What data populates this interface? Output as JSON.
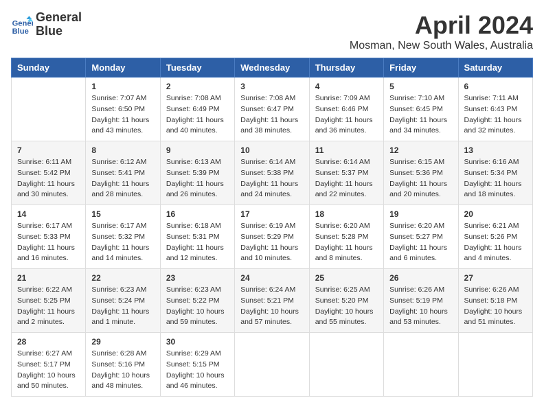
{
  "header": {
    "logo_line1": "General",
    "logo_line2": "Blue",
    "month_year": "April 2024",
    "location": "Mosman, New South Wales, Australia"
  },
  "weekdays": [
    "Sunday",
    "Monday",
    "Tuesday",
    "Wednesday",
    "Thursday",
    "Friday",
    "Saturday"
  ],
  "weeks": [
    [
      {
        "day": "",
        "content": ""
      },
      {
        "day": "1",
        "content": "Sunrise: 7:07 AM\nSunset: 6:50 PM\nDaylight: 11 hours\nand 43 minutes."
      },
      {
        "day": "2",
        "content": "Sunrise: 7:08 AM\nSunset: 6:49 PM\nDaylight: 11 hours\nand 40 minutes."
      },
      {
        "day": "3",
        "content": "Sunrise: 7:08 AM\nSunset: 6:47 PM\nDaylight: 11 hours\nand 38 minutes."
      },
      {
        "day": "4",
        "content": "Sunrise: 7:09 AM\nSunset: 6:46 PM\nDaylight: 11 hours\nand 36 minutes."
      },
      {
        "day": "5",
        "content": "Sunrise: 7:10 AM\nSunset: 6:45 PM\nDaylight: 11 hours\nand 34 minutes."
      },
      {
        "day": "6",
        "content": "Sunrise: 7:11 AM\nSunset: 6:43 PM\nDaylight: 11 hours\nand 32 minutes."
      }
    ],
    [
      {
        "day": "7",
        "content": "Sunrise: 6:11 AM\nSunset: 5:42 PM\nDaylight: 11 hours\nand 30 minutes."
      },
      {
        "day": "8",
        "content": "Sunrise: 6:12 AM\nSunset: 5:41 PM\nDaylight: 11 hours\nand 28 minutes."
      },
      {
        "day": "9",
        "content": "Sunrise: 6:13 AM\nSunset: 5:39 PM\nDaylight: 11 hours\nand 26 minutes."
      },
      {
        "day": "10",
        "content": "Sunrise: 6:14 AM\nSunset: 5:38 PM\nDaylight: 11 hours\nand 24 minutes."
      },
      {
        "day": "11",
        "content": "Sunrise: 6:14 AM\nSunset: 5:37 PM\nDaylight: 11 hours\nand 22 minutes."
      },
      {
        "day": "12",
        "content": "Sunrise: 6:15 AM\nSunset: 5:36 PM\nDaylight: 11 hours\nand 20 minutes."
      },
      {
        "day": "13",
        "content": "Sunrise: 6:16 AM\nSunset: 5:34 PM\nDaylight: 11 hours\nand 18 minutes."
      }
    ],
    [
      {
        "day": "14",
        "content": "Sunrise: 6:17 AM\nSunset: 5:33 PM\nDaylight: 11 hours\nand 16 minutes."
      },
      {
        "day": "15",
        "content": "Sunrise: 6:17 AM\nSunset: 5:32 PM\nDaylight: 11 hours\nand 14 minutes."
      },
      {
        "day": "16",
        "content": "Sunrise: 6:18 AM\nSunset: 5:31 PM\nDaylight: 11 hours\nand 12 minutes."
      },
      {
        "day": "17",
        "content": "Sunrise: 6:19 AM\nSunset: 5:29 PM\nDaylight: 11 hours\nand 10 minutes."
      },
      {
        "day": "18",
        "content": "Sunrise: 6:20 AM\nSunset: 5:28 PM\nDaylight: 11 hours\nand 8 minutes."
      },
      {
        "day": "19",
        "content": "Sunrise: 6:20 AM\nSunset: 5:27 PM\nDaylight: 11 hours\nand 6 minutes."
      },
      {
        "day": "20",
        "content": "Sunrise: 6:21 AM\nSunset: 5:26 PM\nDaylight: 11 hours\nand 4 minutes."
      }
    ],
    [
      {
        "day": "21",
        "content": "Sunrise: 6:22 AM\nSunset: 5:25 PM\nDaylight: 11 hours\nand 2 minutes."
      },
      {
        "day": "22",
        "content": "Sunrise: 6:23 AM\nSunset: 5:24 PM\nDaylight: 11 hours\nand 1 minute."
      },
      {
        "day": "23",
        "content": "Sunrise: 6:23 AM\nSunset: 5:22 PM\nDaylight: 10 hours\nand 59 minutes."
      },
      {
        "day": "24",
        "content": "Sunrise: 6:24 AM\nSunset: 5:21 PM\nDaylight: 10 hours\nand 57 minutes."
      },
      {
        "day": "25",
        "content": "Sunrise: 6:25 AM\nSunset: 5:20 PM\nDaylight: 10 hours\nand 55 minutes."
      },
      {
        "day": "26",
        "content": "Sunrise: 6:26 AM\nSunset: 5:19 PM\nDaylight: 10 hours\nand 53 minutes."
      },
      {
        "day": "27",
        "content": "Sunrise: 6:26 AM\nSunset: 5:18 PM\nDaylight: 10 hours\nand 51 minutes."
      }
    ],
    [
      {
        "day": "28",
        "content": "Sunrise: 6:27 AM\nSunset: 5:17 PM\nDaylight: 10 hours\nand 50 minutes."
      },
      {
        "day": "29",
        "content": "Sunrise: 6:28 AM\nSunset: 5:16 PM\nDaylight: 10 hours\nand 48 minutes."
      },
      {
        "day": "30",
        "content": "Sunrise: 6:29 AM\nSunset: 5:15 PM\nDaylight: 10 hours\nand 46 minutes."
      },
      {
        "day": "",
        "content": ""
      },
      {
        "day": "",
        "content": ""
      },
      {
        "day": "",
        "content": ""
      },
      {
        "day": "",
        "content": ""
      }
    ]
  ]
}
